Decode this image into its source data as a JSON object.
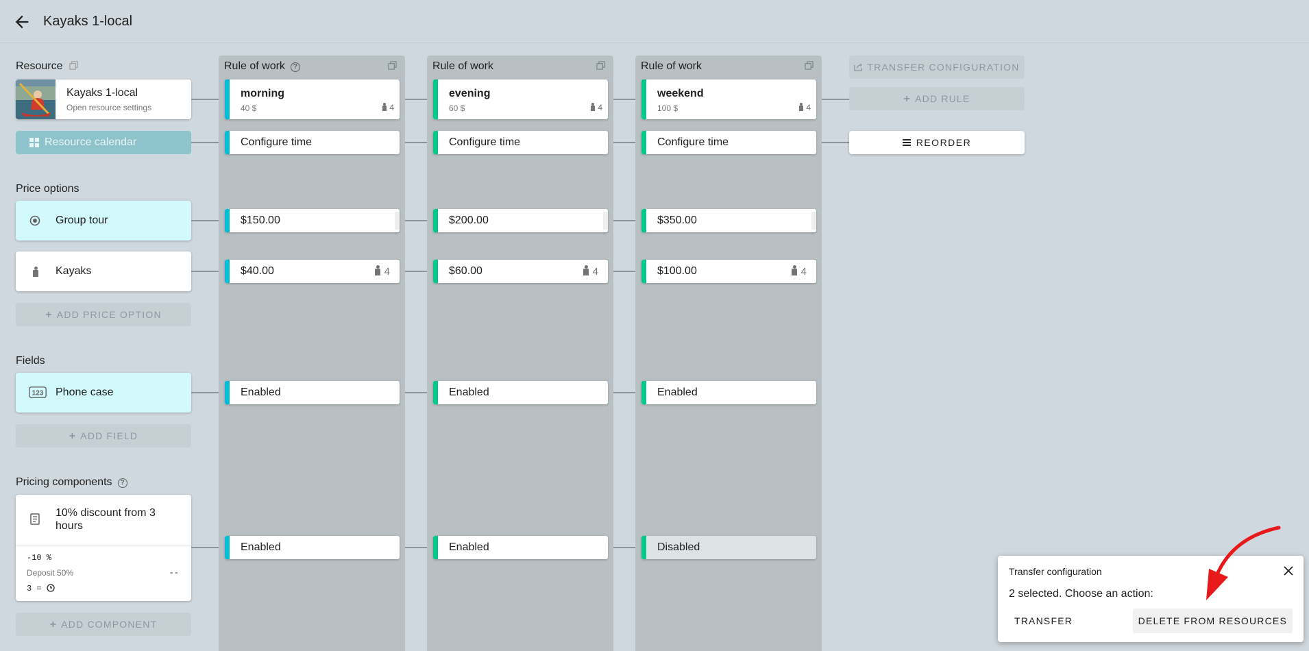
{
  "header": {
    "title": "Kayaks 1-local"
  },
  "resource": {
    "section_label": "Resource",
    "name": "Kayaks 1-local",
    "subtitle": "Open resource settings",
    "calendar_label": "Resource calendar"
  },
  "price_options": {
    "section_label": "Price options",
    "items": [
      {
        "label": "Group tour",
        "icon": "radio-target-icon"
      },
      {
        "label": "Kayaks",
        "icon": "person-icon"
      }
    ],
    "add_label": "ADD PRICE OPTION"
  },
  "fields": {
    "section_label": "Fields",
    "items": [
      {
        "label": "Phone case",
        "icon": "numeric-123-icon"
      }
    ],
    "add_label": "ADD FIELD"
  },
  "pricing_components": {
    "section_label": "Pricing components",
    "items": [
      {
        "label": "10% discount from 3 hours",
        "discount": "-10 %",
        "deposit": "Deposit 50%",
        "dash": "--",
        "condition_num": "3",
        "condition_op": "="
      }
    ],
    "add_label": "ADD COMPONENT"
  },
  "rules": [
    {
      "header": "Rule of work",
      "name": "morning",
      "price": "40 $",
      "capacity": "4",
      "configure": "Configure time",
      "po": [
        "$150.00",
        "$40.00"
      ],
      "po_capacity": "4",
      "field": "Enabled",
      "component": "Enabled",
      "color": "#00bcd4"
    },
    {
      "header": "Rule of work",
      "name": "evening",
      "price": "60 $",
      "capacity": "4",
      "configure": "Configure time",
      "po": [
        "$200.00",
        "$60.00"
      ],
      "po_capacity": "4",
      "field": "Enabled",
      "component": "Enabled",
      "color": "#00c98a"
    },
    {
      "header": "Rule of work",
      "name": "weekend",
      "price": "100 $",
      "capacity": "4",
      "configure": "Configure time",
      "po": [
        "$350.00",
        "$100.00"
      ],
      "po_capacity": "4",
      "field": "Enabled",
      "component": "Disabled",
      "color": "#00c98a"
    }
  ],
  "actions": {
    "transfer": "TRANSFER CONFIGURATION",
    "add_rule": "ADD RULE",
    "reorder": "REORDER"
  },
  "popup": {
    "title": "Transfer configuration",
    "message": "2 selected. Choose an action:",
    "transfer": "TRANSFER",
    "delete": "DELETE FROM RESOURCES"
  },
  "colors": {
    "background": "#cfd8de",
    "column": "#b8c0c3",
    "cyan_strip": "#00bcd4",
    "green_strip": "#00c98a",
    "highlight": "#d2f9fc",
    "arrow": "#e8191a"
  }
}
